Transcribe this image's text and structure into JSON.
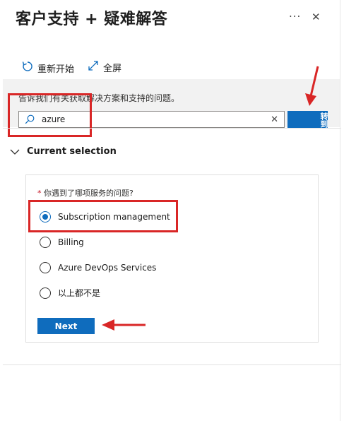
{
  "header": {
    "title": "客户支持 + 疑难解答",
    "more_label": "...",
    "close_label": "✕"
  },
  "toolbar": {
    "restart_label": "重新开始",
    "fullscreen_label": "全屏"
  },
  "search": {
    "prompt": "告诉我们有关获取解决方案和支持的问题。",
    "value": "azure",
    "clear_label": "✕",
    "go_label": "转到"
  },
  "current_selection": {
    "heading": "Current selection"
  },
  "question": {
    "required_mark": "*",
    "label": "你遇到了哪项服务的问题?",
    "options": [
      {
        "label": "Subscription management",
        "selected": true
      },
      {
        "label": "Billing",
        "selected": false
      },
      {
        "label": "Azure DevOps Services",
        "selected": false
      },
      {
        "label": "以上都不是",
        "selected": false
      }
    ]
  },
  "next_label": "Next",
  "colors": {
    "accent": "#0f6cbd",
    "annotation_red": "#d92626"
  }
}
